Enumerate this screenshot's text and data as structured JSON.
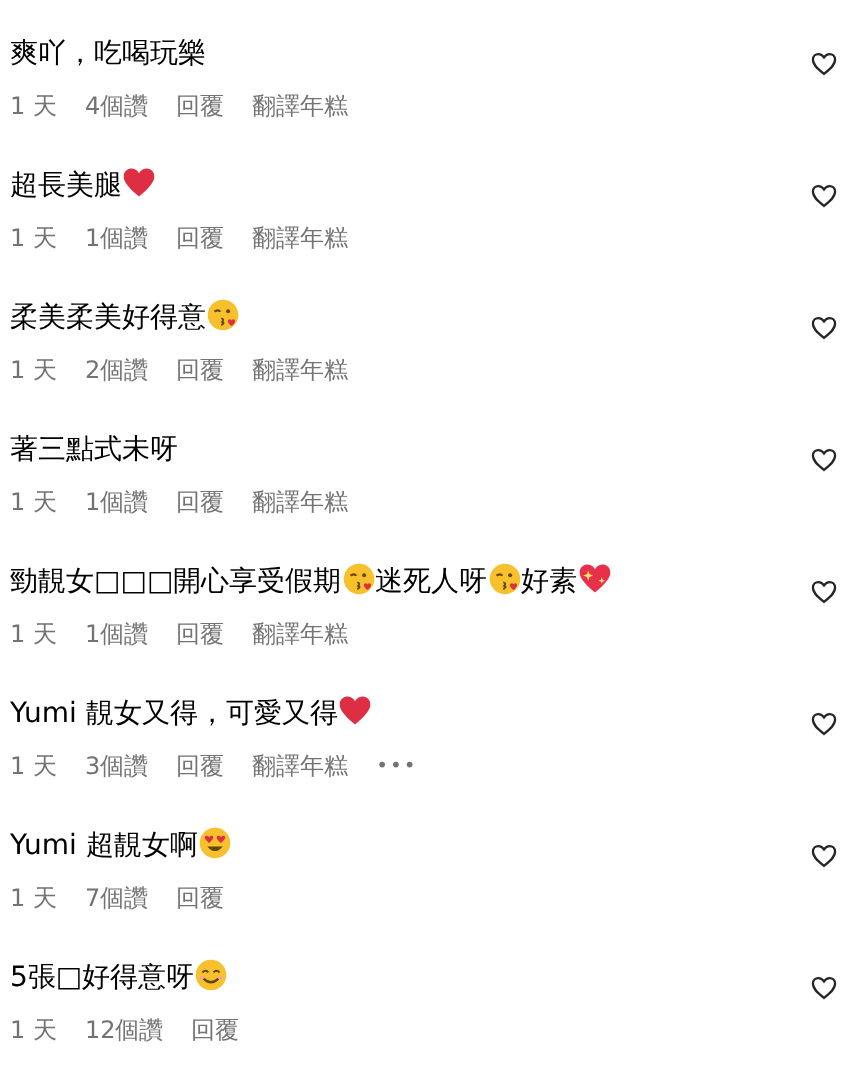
{
  "comments": [
    {
      "segments": [
        {
          "kind": "text",
          "text": "爽吖，吃喝玩樂"
        }
      ],
      "time": "1 天",
      "likes": "4個讚",
      "reply": "回覆",
      "translate": "翻譯年糕",
      "liked": false
    },
    {
      "segments": [
        {
          "kind": "text",
          "text": "超長美腿"
        },
        {
          "kind": "heart"
        }
      ],
      "time": "1 天",
      "likes": "1個讚",
      "reply": "回覆",
      "translate": "翻譯年糕",
      "liked": false
    },
    {
      "segments": [
        {
          "kind": "text",
          "text": "柔美柔美好得意"
        },
        {
          "kind": "kiss"
        }
      ],
      "time": "1 天",
      "likes": "2個讚",
      "reply": "回覆",
      "translate": "翻譯年糕",
      "liked": false
    },
    {
      "segments": [
        {
          "kind": "text",
          "text": "著三點式未呀"
        }
      ],
      "time": "1 天",
      "likes": "1個讚",
      "reply": "回覆",
      "translate": "翻譯年糕",
      "liked": false
    },
    {
      "segments": [
        {
          "kind": "text",
          "text": "勁靚女□□□開心享受假期"
        },
        {
          "kind": "kiss"
        },
        {
          "kind": "text",
          "text": "迷死人呀"
        },
        {
          "kind": "kiss"
        },
        {
          "kind": "text",
          "text": "好素"
        },
        {
          "kind": "sparkle-heart"
        }
      ],
      "time": "1 天",
      "likes": "1個讚",
      "reply": "回覆",
      "translate": "翻譯年糕",
      "liked": false
    },
    {
      "segments": [
        {
          "kind": "text",
          "text": "Yumi 靚女又得，可愛又得"
        },
        {
          "kind": "heart"
        }
      ],
      "time": "1 天",
      "likes": "3個讚",
      "reply": "回覆",
      "translate": "翻譯年糕",
      "more": "•••",
      "liked": false
    },
    {
      "segments": [
        {
          "kind": "text",
          "text": "Yumi 超靚女啊"
        },
        {
          "kind": "heart-eyes"
        }
      ],
      "time": "1 天",
      "likes": "7個讚",
      "reply": "回覆",
      "liked": false
    },
    {
      "segments": [
        {
          "kind": "text",
          "text": "5張□好得意呀"
        },
        {
          "kind": "smile"
        }
      ],
      "time": "1 天",
      "likes": "12個讚",
      "reply": "回覆",
      "liked": false
    }
  ]
}
